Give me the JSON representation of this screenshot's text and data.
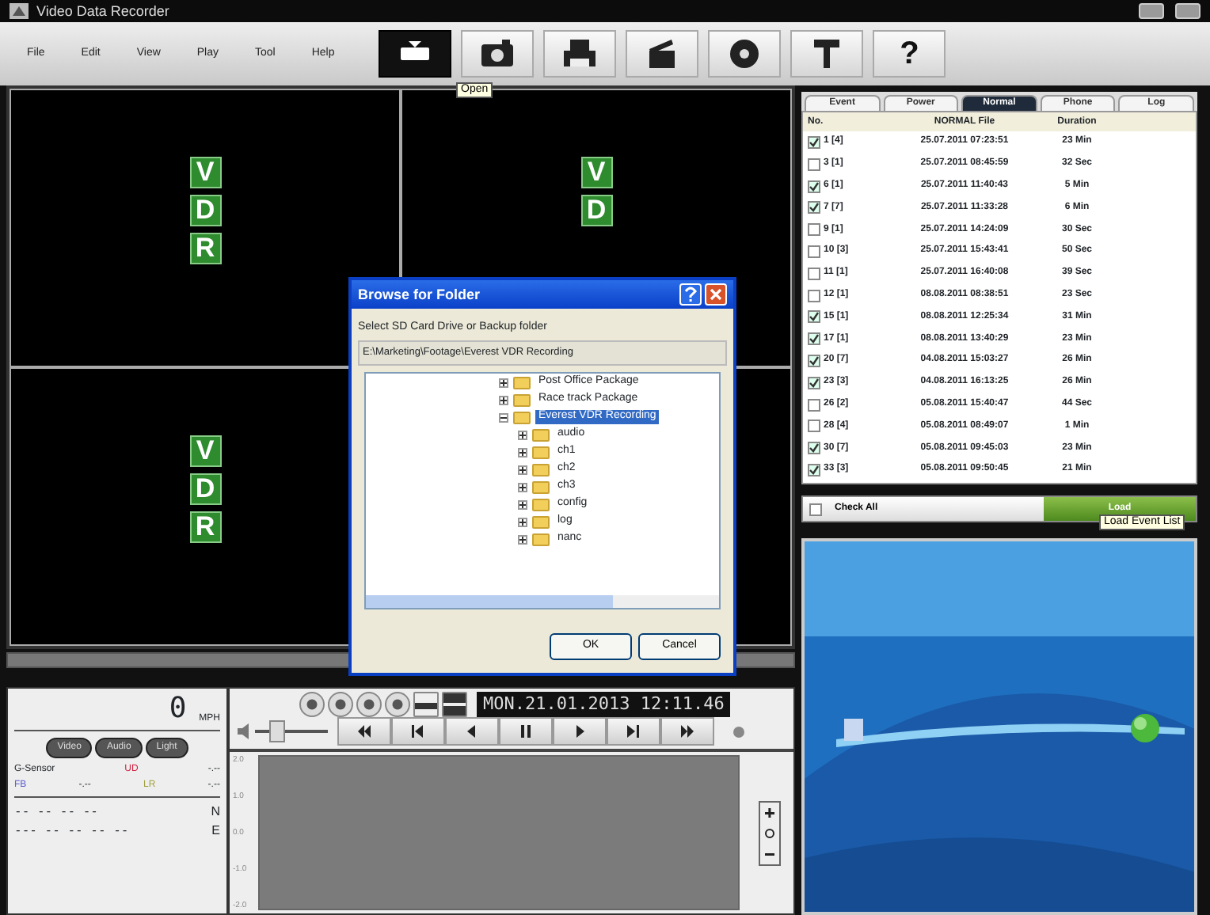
{
  "window": {
    "title": "Video Data Recorder"
  },
  "menu": [
    "File",
    "Edit",
    "View",
    "Play",
    "Tool",
    "Help"
  ],
  "toolbar": [
    {
      "kind": "open",
      "selected": true
    },
    {
      "kind": "camera",
      "selected": false
    },
    {
      "kind": "printer",
      "selected": false
    },
    {
      "kind": "clapper",
      "selected": false
    },
    {
      "kind": "disc",
      "selected": false
    },
    {
      "kind": "tool",
      "selected": false
    },
    {
      "kind": "help",
      "label": "?",
      "selected": false
    }
  ],
  "toolbar_tooltip": "Open",
  "video_cells": [
    {
      "letters": [
        "V",
        "D",
        "R"
      ]
    },
    {
      "letters": [
        "V",
        "D"
      ]
    },
    {
      "letters": [
        "V",
        "D",
        "R"
      ]
    },
    {}
  ],
  "dialog": {
    "title": "Browse for Folder",
    "prompt": "Select SD Card Drive or Backup folder",
    "path": "E:\\Marketing\\Footage\\Everest VDR Recording",
    "tree": [
      {
        "label": "Post Office Package",
        "expanded": false,
        "selected": false
      },
      {
        "label": "Race track Package",
        "expanded": false,
        "selected": false
      },
      {
        "label": "Everest VDR Recording",
        "expanded": true,
        "selected": true,
        "children": [
          {
            "label": "audio",
            "expanded": false,
            "selected": false
          },
          {
            "label": "ch1",
            "expanded": false,
            "selected": false
          },
          {
            "label": "ch2",
            "expanded": false,
            "selected": false
          },
          {
            "label": "ch3",
            "expanded": false,
            "selected": false
          },
          {
            "label": "config",
            "expanded": false,
            "selected": false
          },
          {
            "label": "log",
            "expanded": false,
            "selected": false
          },
          {
            "label": "nanc",
            "expanded": false,
            "selected": false
          }
        ]
      }
    ],
    "buttons": [
      "OK",
      "Cancel"
    ]
  },
  "gauges": {
    "speed": "0",
    "unit": "MPH",
    "mode_buttons": [
      "Video",
      "Audio",
      "Light"
    ],
    "sensor_rows": [
      [
        "G-Sensor",
        "UD",
        "-.--"
      ],
      [
        "FB",
        "-.--",
        "LR",
        "-.--"
      ]
    ],
    "gps_rows": [
      {
        "value": "-- -- -- --",
        "dir": "N"
      },
      {
        "value": "--- -- -- -- --",
        "dir": "E"
      }
    ]
  },
  "player": {
    "view_buttons": [
      {
        "kind": "round"
      },
      {
        "kind": "round"
      },
      {
        "kind": "round"
      },
      {
        "kind": "round"
      },
      {
        "kind": "single"
      },
      {
        "kind": "quad"
      }
    ],
    "timestamp": "MON.21.01.2013 12:11.46",
    "volume": {
      "level": 0.25
    },
    "transport": [
      {
        "kind": "rewind"
      },
      {
        "kind": "previous"
      },
      {
        "kind": "step-back"
      },
      {
        "kind": "pause"
      },
      {
        "kind": "play"
      },
      {
        "kind": "next"
      },
      {
        "kind": "fast-forward"
      }
    ],
    "y_axis_labels": [
      "2.0",
      "1.0",
      "0.0",
      "-1.0",
      "-2.0"
    ]
  },
  "tabs": [
    {
      "label": "Event",
      "selected": false
    },
    {
      "label": "Power",
      "selected": false
    },
    {
      "label": "Normal",
      "selected": true
    },
    {
      "label": "Phone",
      "selected": false
    },
    {
      "label": "Log",
      "selected": false
    }
  ],
  "table": {
    "columns": [
      "No.",
      "NORMAL File",
      "Duration"
    ],
    "rows": [
      {
        "no": "1 [4]",
        "file": "25.07.2011 07:23:51",
        "duration": "23 Min",
        "checked": true
      },
      {
        "no": "3 [1]",
        "file": "25.07.2011 08:45:59",
        "duration": "32 Sec",
        "checked": false
      },
      {
        "no": "6 [1]",
        "file": "25.07.2011 11:40:43",
        "duration": "5 Min",
        "checked": true
      },
      {
        "no": "7 [7]",
        "file": "25.07.2011 11:33:28",
        "duration": "6 Min",
        "checked": true
      },
      {
        "no": "9 [1]",
        "file": "25.07.2011 14:24:09",
        "duration": "30 Sec",
        "checked": false
      },
      {
        "no": "10 [3]",
        "file": "25.07.2011 15:43:41",
        "duration": "50 Sec",
        "checked": false
      },
      {
        "no": "11 [1]",
        "file": "25.07.2011 16:40:08",
        "duration": "39 Sec",
        "checked": false
      },
      {
        "no": "12 [1]",
        "file": "08.08.2011 08:38:51",
        "duration": "23 Sec",
        "checked": false
      },
      {
        "no": "15 [1]",
        "file": "08.08.2011 12:25:34",
        "duration": "31 Min",
        "checked": true
      },
      {
        "no": "17 [1]",
        "file": "08.08.2011 13:40:29",
        "duration": "23 Min",
        "checked": true
      },
      {
        "no": "20 [7]",
        "file": "04.08.2011 15:03:27",
        "duration": "26 Min",
        "checked": true
      },
      {
        "no": "23 [3]",
        "file": "04.08.2011 16:13:25",
        "duration": "26 Min",
        "checked": true
      },
      {
        "no": "26 [2]",
        "file": "05.08.2011 15:40:47",
        "duration": "44 Sec",
        "checked": false
      },
      {
        "no": "28 [4]",
        "file": "05.08.2011 08:49:07",
        "duration": "1 Min",
        "checked": false
      },
      {
        "no": "30 [7]",
        "file": "05.08.2011 09:45:03",
        "duration": "23 Min",
        "checked": true
      },
      {
        "no": "33 [3]",
        "file": "05.08.2011 09:50:45",
        "duration": "21 Min",
        "checked": true
      }
    ]
  },
  "check_all": {
    "label": "Check All",
    "checked": false
  },
  "load_button": "Load",
  "load_tooltip": "Load Event List"
}
